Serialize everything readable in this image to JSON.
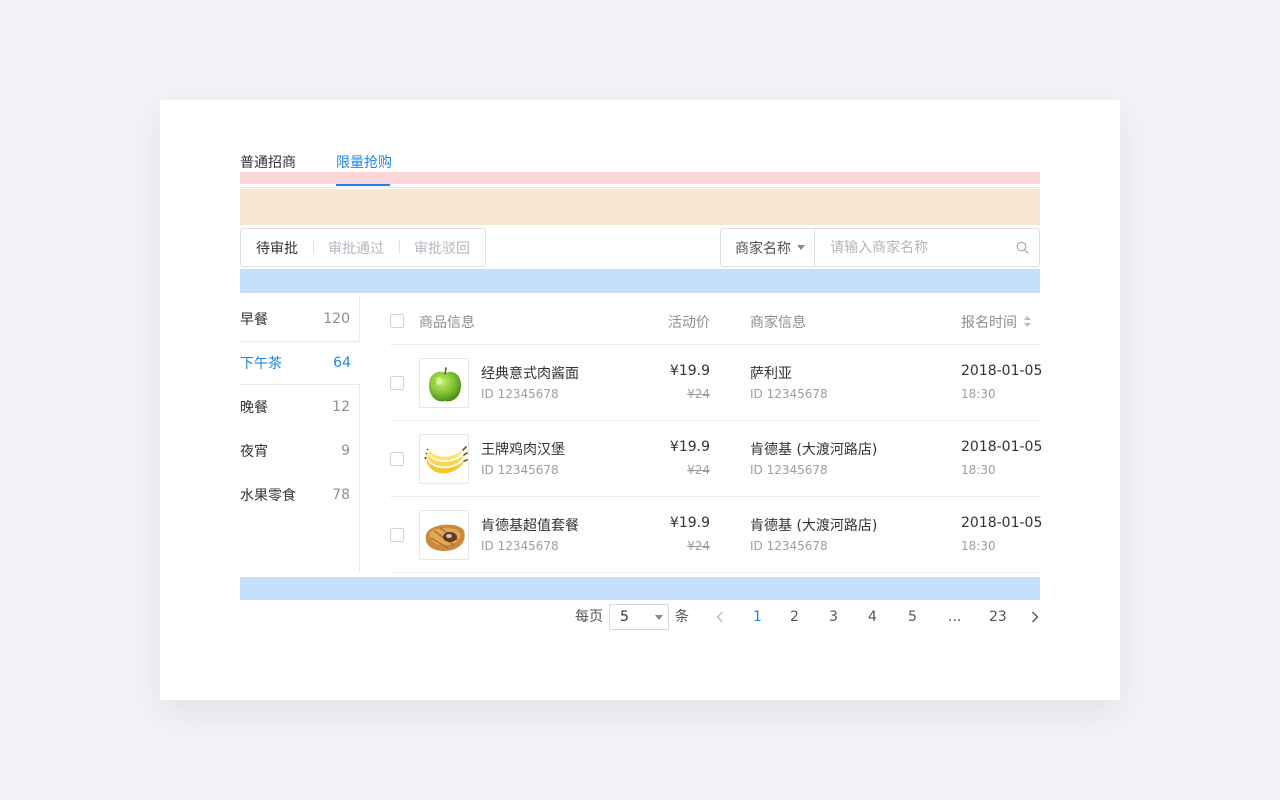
{
  "tabs": [
    {
      "label": "普通招商"
    },
    {
      "label": "限量抢购"
    }
  ],
  "active_tab": 1,
  "status_filters": [
    {
      "label": "待审批"
    },
    {
      "label": "审批通过"
    },
    {
      "label": "审批驳回"
    }
  ],
  "search": {
    "field_label": "商家名称",
    "placeholder": "请输入商家名称",
    "value": ""
  },
  "categories": [
    {
      "label": "早餐",
      "count": "120"
    },
    {
      "label": "下午茶",
      "count": "64"
    },
    {
      "label": "晚餐",
      "count": "12"
    },
    {
      "label": "夜宵",
      "count": "9"
    },
    {
      "label": "水果零食",
      "count": "78"
    }
  ],
  "table": {
    "headers": {
      "product": "商品信息",
      "price": "活动价",
      "merchant": "商家信息",
      "time": "报名时间"
    },
    "rows": [
      {
        "name": "经典意式肉酱面",
        "id": "ID 12345678",
        "price": "¥19.9",
        "original_price": "¥24",
        "merchant": "萨利亚",
        "merchant_id": "ID 12345678",
        "date": "2018-01-05",
        "time": "18:30",
        "image": "green-apple-image"
      },
      {
        "name": "王牌鸡肉汉堡",
        "id": "ID 12345678",
        "price": "¥19.9",
        "original_price": "¥24",
        "merchant": "肯德基 (大渡河路店)",
        "merchant_id": "ID 12345678",
        "date": "2018-01-05",
        "time": "18:30",
        "image": "banana-image"
      },
      {
        "name": "肯德基超值套餐",
        "id": "ID 12345678",
        "price": "¥19.9",
        "original_price": "¥24",
        "merchant": "肯德基 (大渡河路店)",
        "merchant_id": "ID 12345678",
        "date": "2018-01-05",
        "time": "18:30",
        "image": "pastry-image"
      }
    ]
  },
  "pagination": {
    "per_page_prefix": "每页",
    "per_page_value": "5",
    "per_page_suffix": "条",
    "pages": [
      "1",
      "2",
      "3",
      "4",
      "5",
      "...",
      "23"
    ],
    "current": "1"
  },
  "colors": {
    "accent": "#1c86e8",
    "band_red": "#fbd6d8",
    "band_orange": "#f7e6d0",
    "band_blue": "#c4e0fc"
  }
}
